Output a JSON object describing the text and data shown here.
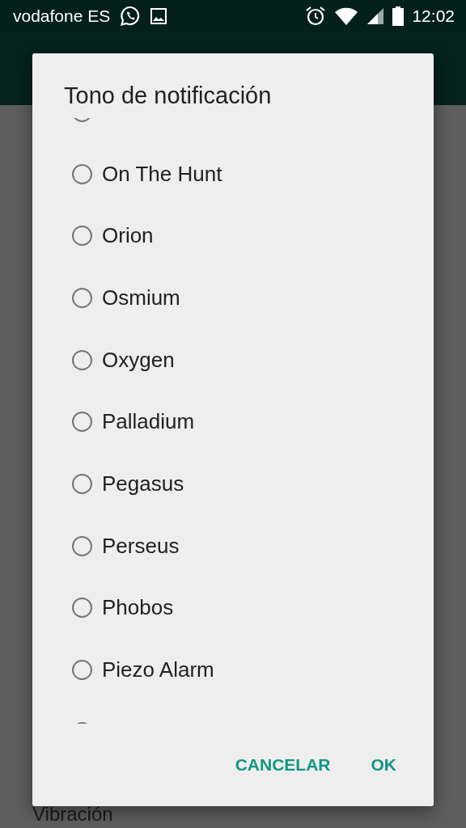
{
  "status_bar": {
    "carrier": "vodafone ES",
    "time": "12:02"
  },
  "background": {
    "items": [
      {
        "label": "Vibración"
      }
    ]
  },
  "dialog": {
    "title": "Tono de notificación",
    "options": [
      {
        "selected": false
      },
      {
        "label": "On The Hunt",
        "selected": false
      },
      {
        "label": "Orion",
        "selected": false
      },
      {
        "label": "Osmium",
        "selected": false
      },
      {
        "label": "Oxygen",
        "selected": false
      },
      {
        "label": "Palladium",
        "selected": false
      },
      {
        "label": "Pegasus",
        "selected": false
      },
      {
        "label": "Perseus",
        "selected": false
      },
      {
        "label": "Phobos",
        "selected": false
      },
      {
        "label": "Piezo Alarm",
        "selected": false
      },
      {
        "selected": false
      }
    ],
    "buttons": [
      "CANCELAR",
      "OK"
    ]
  }
}
